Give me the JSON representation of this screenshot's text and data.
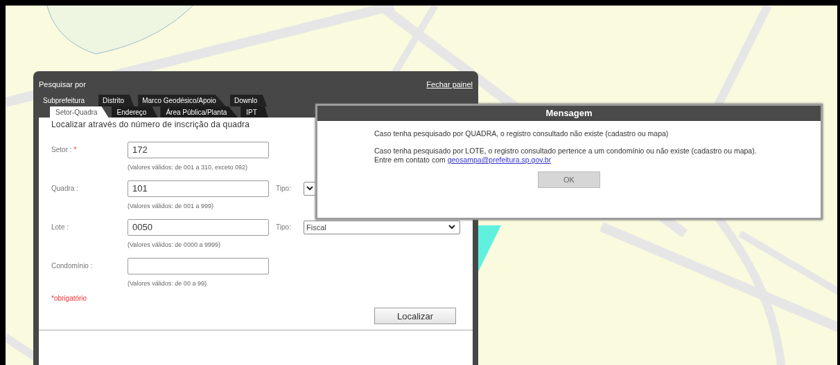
{
  "panel": {
    "title": "Pesquisar por",
    "close_link": "Fechar painel",
    "tabs": [
      {
        "label": "Subprefeitura",
        "selected": true
      },
      {
        "label": "Distrito",
        "selected": false
      },
      {
        "label": "Marco Geodésico/Apoio",
        "selected": false
      },
      {
        "label": "Downlo",
        "selected": false
      }
    ],
    "subtabs": [
      {
        "label": "Setor-Quadra",
        "selected": true
      },
      {
        "label": "Endereço",
        "selected": false
      },
      {
        "label": "Área Pública/Planta",
        "selected": false
      },
      {
        "label": "IPT",
        "selected": false
      }
    ],
    "heading": "Localizar através do número de inscrição da quadra",
    "fields": [
      {
        "label": "Setor :",
        "required_mark": "*",
        "value": "172",
        "hint": "(Valores válidos: de 001 a 310, exceto 092)"
      },
      {
        "label": "Quadra :",
        "value": "101",
        "hint": "(Valores válidos: de 001 a 999)",
        "tipo": {
          "label": "Tipo:"
        }
      },
      {
        "label": "Lote :",
        "value": "0050",
        "hint": "(Valores válidos: de 0000 a 9999)",
        "tipo": {
          "label": "Tipo:",
          "value": "Fiscal"
        }
      },
      {
        "label": "Condomínio :",
        "hint": "(Valores válidos: de 00 a 99)"
      }
    ],
    "required_note": "*obrigatório",
    "button": "Localizar"
  },
  "dialog": {
    "title": "Mensagem",
    "paragraphs": [
      {
        "text": "Caso tenha pesquisado por QUADRA, o registro consultado não existe (cadastro ou mapa)"
      },
      {
        "text": "Caso tenha pesquisado por LOTE, o registro consultado pertence a um condomínio ou não existe (cadastro ou mapa). Entre em contato com ",
        "link": "geosampa@prefeitura.sp.gov.br"
      }
    ],
    "button": "OK"
  }
}
